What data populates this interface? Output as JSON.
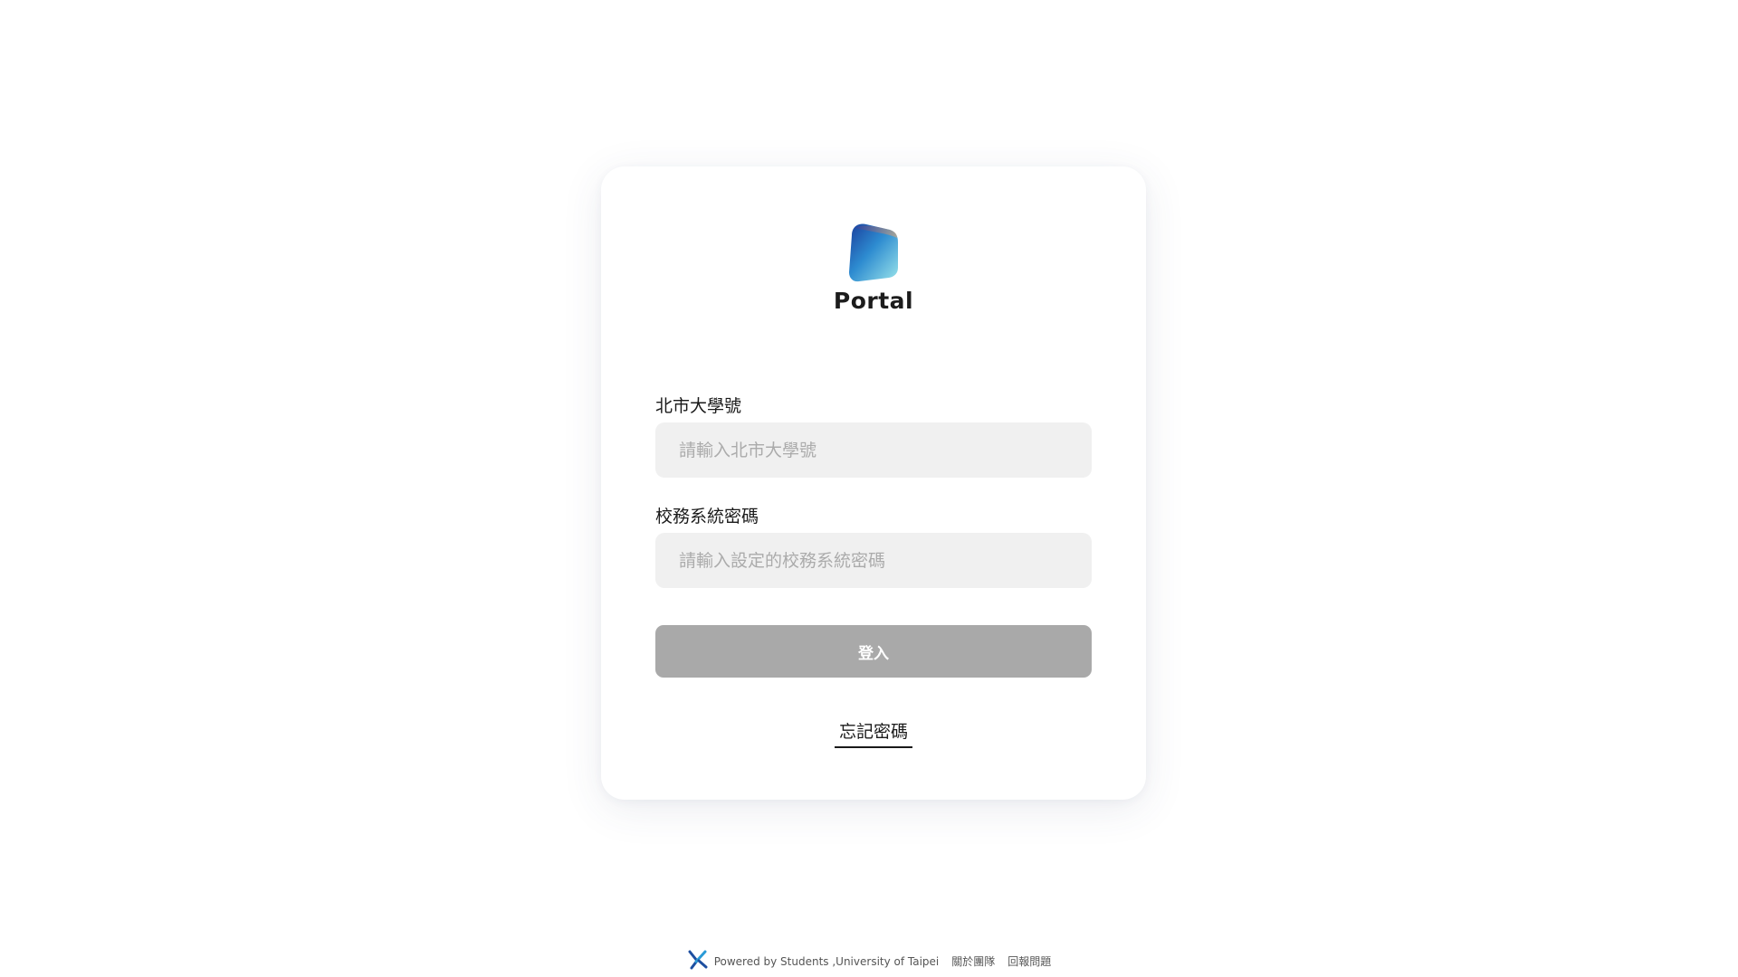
{
  "logo": {
    "icon": "portal-logo-icon",
    "text": "Portal"
  },
  "login_form": {
    "student_id": {
      "label": "北市大學號",
      "placeholder": "請輸入北市大學號",
      "value": ""
    },
    "password": {
      "label": "校務系統密碼",
      "placeholder": "請輸入設定的校務系統密碼",
      "value": ""
    },
    "submit_label": "登入",
    "forgot_password_label": "忘記密碼"
  },
  "footer": {
    "icon": "university-logo-icon",
    "powered_by": "Powered by Students ,University of Taipei",
    "about_link": "關於團隊",
    "report_link": "回報問題"
  },
  "colors": {
    "card_background": "#ffffff",
    "input_background": "#f0f0f0",
    "button_disabled": "#a9a9a9",
    "logo_gradient": [
      "#1a3e9c",
      "#2f8fd2",
      "#8fe0e8"
    ]
  }
}
